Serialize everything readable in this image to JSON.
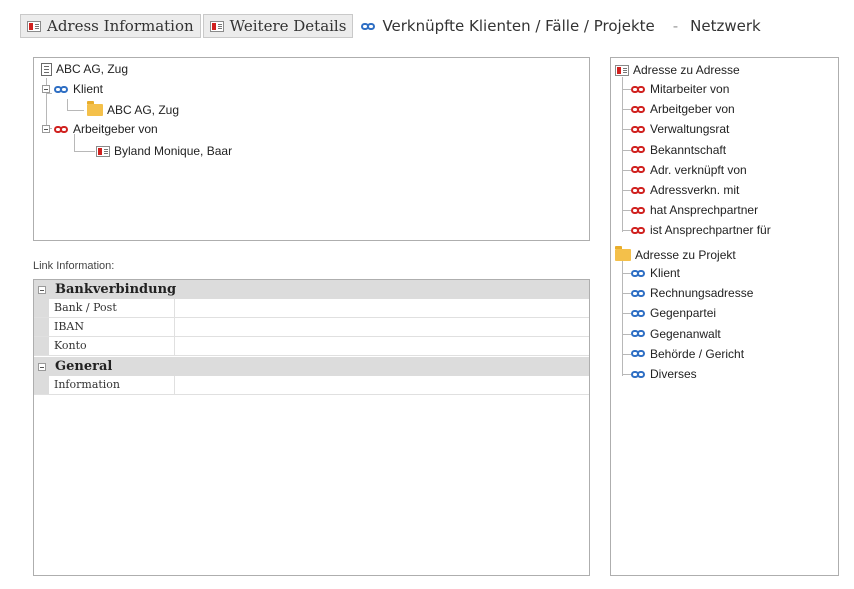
{
  "tabs": [
    {
      "label": "Adress Information",
      "icon": "address-card-icon"
    },
    {
      "label": "Weitere Details",
      "icon": "details-card-icon"
    },
    {
      "label": "Verknüpfte Klienten / Fälle / Projekte",
      "icon": "link-icon"
    },
    {
      "label": "Netzwerk",
      "icon": ""
    }
  ],
  "tab_separator": "-",
  "tree": {
    "root": "ABC AG, Zug",
    "groups": [
      {
        "label": "Klient",
        "children": [
          "ABC AG, Zug"
        ]
      },
      {
        "label": "Arbeitgeber von",
        "children": [
          "Byland Monique, Baar"
        ]
      }
    ]
  },
  "link_info": {
    "label": "Link Information:",
    "categories": [
      {
        "name": "Bankverbindung",
        "rows": [
          "Bank / Post",
          "IBAN",
          "Konto"
        ]
      },
      {
        "name": "General",
        "rows": [
          "Information"
        ]
      }
    ]
  },
  "relations": {
    "address_group": {
      "label": "Adresse zu Adresse",
      "items": [
        "Mitarbeiter von",
        "Arbeitgeber von",
        "Verwaltungsrat",
        "Bekanntschaft",
        "Adr. verknüpft von",
        "Adressverkn. mit",
        "hat Ansprechpartner",
        "ist Ansprechpartner für"
      ]
    },
    "project_group": {
      "label": "Adresse zu Projekt",
      "items": [
        "Klient",
        "Rechnungsadresse",
        "Gegenpartei",
        "Gegenanwalt",
        "Behörde / Gericht",
        "Diverses"
      ]
    }
  },
  "colors": {
    "link_blue": "#2f6fc4",
    "link_red": "#d0211f",
    "folder_yellow": "#f4c04a",
    "category_gray": "#dcdcdc"
  }
}
